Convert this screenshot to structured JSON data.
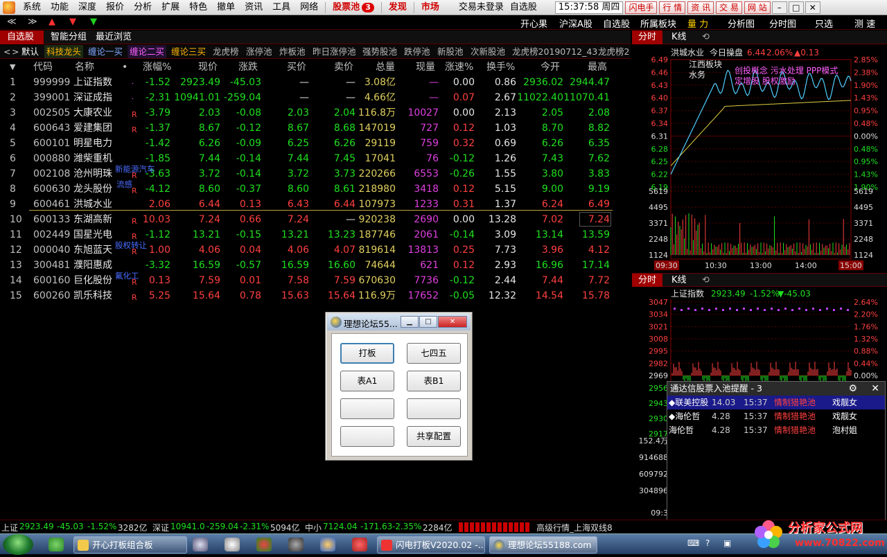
{
  "menubar": {
    "items": [
      "系统",
      "功能",
      "深度",
      "报价",
      "分析",
      "扩展",
      "特色",
      "撤单",
      "资讯",
      "工具",
      "网络"
    ],
    "stock_pool": "股票池",
    "stock_pool_count": "3",
    "discover": "发现",
    "market": "市场",
    "login_status": "交易未登录",
    "watchlist": "自选股",
    "time": "15:37:58 周四",
    "right_buttons": [
      "闪电手",
      "行 情",
      "资 讯",
      "交 易",
      "网 站"
    ]
  },
  "toolbar": {
    "links": [
      "开心果",
      "沪深A股",
      "自选股",
      "所属板块",
      "量 力",
      "分析图",
      "分时图",
      "只选",
      "测 速"
    ]
  },
  "left_tabs": [
    "自选股",
    "智能分组",
    "最近浏览"
  ],
  "sub_tabs": [
    "默认",
    "科技龙头",
    "缠论一买",
    "缠论二买",
    "缠论三买",
    "龙虎榜",
    "涨停池",
    "炸板池",
    "昨日涨停池",
    "强势股池",
    "跌停池",
    "新股池",
    "次新股池",
    "龙虎榜20190712_43",
    "龙虎榜2"
  ],
  "table": {
    "headers": [
      "代码",
      "名称",
      "•",
      "涨幅%",
      "现价",
      "涨跌",
      "买价",
      "卖价",
      "总量",
      "现量",
      "涨速%",
      "换手%",
      "今开",
      "最高"
    ],
    "rows": [
      {
        "n": "1",
        "code": "999999",
        "name": "上证指数",
        "flag": "·",
        "chg": "-1.52",
        "price": "2923.49",
        "diff": "-45.03",
        "bid": "—",
        "ask": "—",
        "vol": "3.08亿",
        "cur": "—",
        "spd": "0.00",
        "turn": "0.86",
        "open": "2936.02",
        "high": "2944.47"
      },
      {
        "n": "2",
        "code": "399001",
        "name": "深证成指",
        "flag": "·",
        "chg": "-2.31",
        "price": "10941.01",
        "diff": "-259.04",
        "bid": "—",
        "ask": "—",
        "vol": "4.66亿",
        "cur": "—",
        "spd": "0.07",
        "turn": "2.67",
        "open": "11022.40",
        "high": "11070.41"
      },
      {
        "n": "3",
        "code": "002505",
        "name": "大康农业",
        "flag": "R",
        "chg": "-3.79",
        "price": "2.03",
        "diff": "-0.08",
        "bid": "2.03",
        "ask": "2.04",
        "vol": "116.8万",
        "cur": "10027",
        "spd": "0.00",
        "turn": "2.13",
        "open": "2.05",
        "high": "2.08"
      },
      {
        "n": "4",
        "code": "600643",
        "name": "爱建集团",
        "flag": "R",
        "chg": "-1.37",
        "price": "8.67",
        "diff": "-0.12",
        "bid": "8.67",
        "ask": "8.68",
        "vol": "147019",
        "cur": "727",
        "spd": "0.12",
        "turn": "1.03",
        "open": "8.70",
        "high": "8.82"
      },
      {
        "n": "5",
        "code": "600101",
        "name": "明星电力",
        "flag": "",
        "chg": "-1.42",
        "price": "6.26",
        "diff": "-0.09",
        "bid": "6.25",
        "ask": "6.26",
        "vol": "29119",
        "cur": "759",
        "spd": "0.32",
        "turn": "0.69",
        "open": "6.26",
        "high": "6.35"
      },
      {
        "n": "6",
        "code": "000880",
        "name": "潍柴重机",
        "flag": "",
        "chg": "-1.85",
        "price": "7.44",
        "diff": "-0.14",
        "bid": "7.44",
        "ask": "7.45",
        "vol": "17041",
        "cur": "76",
        "spd": "-0.12",
        "turn": "1.26",
        "open": "7.43",
        "high": "7.62"
      },
      {
        "n": "7",
        "code": "002108",
        "name": "沧州明珠",
        "flag": "R",
        "chg": "-3.63",
        "price": "3.72",
        "diff": "-0.14",
        "bid": "3.72",
        "ask": "3.73",
        "vol": "220266",
        "cur": "6553",
        "spd": "-0.26",
        "turn": "1.55",
        "open": "3.80",
        "high": "3.83"
      },
      {
        "n": "8",
        "code": "600630",
        "name": "龙头股份",
        "flag": "R",
        "chg": "-4.12",
        "price": "8.60",
        "diff": "-0.37",
        "bid": "8.60",
        "ask": "8.61",
        "vol": "218980",
        "cur": "3418",
        "spd": "0.12",
        "turn": "5.15",
        "open": "9.00",
        "high": "9.19"
      },
      {
        "n": "9",
        "code": "600461",
        "name": "洪城水业",
        "flag": "",
        "chg": "2.06",
        "price": "6.44",
        "diff": "0.13",
        "bid": "6.43",
        "ask": "6.44",
        "vol": "107973",
        "cur": "1233",
        "spd": "0.31",
        "turn": "1.37",
        "open": "6.24",
        "high": "6.49"
      },
      {
        "n": "10",
        "code": "600133",
        "name": "东湖高新",
        "flag": "R",
        "chg": "10.03",
        "price": "7.24",
        "diff": "0.66",
        "bid": "7.24",
        "ask": "—",
        "vol": "920238",
        "cur": "2690",
        "spd": "0.00",
        "turn": "13.28",
        "open": "7.02",
        "high": "7.24"
      },
      {
        "n": "11",
        "code": "002449",
        "name": "国星光电",
        "flag": "R",
        "chg": "-1.12",
        "price": "13.21",
        "diff": "-0.15",
        "bid": "13.21",
        "ask": "13.23",
        "vol": "187746",
        "cur": "2061",
        "spd": "-0.14",
        "turn": "3.09",
        "open": "13.14",
        "high": "13.59"
      },
      {
        "n": "12",
        "code": "000040",
        "name": "东旭蓝天",
        "flag": "R",
        "chg": "1.00",
        "price": "4.06",
        "diff": "0.04",
        "bid": "4.06",
        "ask": "4.07",
        "vol": "819614",
        "cur": "13813",
        "spd": "0.25",
        "turn": "7.73",
        "open": "3.96",
        "high": "4.12"
      },
      {
        "n": "13",
        "code": "300481",
        "name": "濮阳惠成",
        "flag": "",
        "chg": "-3.32",
        "price": "16.59",
        "diff": "-0.57",
        "bid": "16.59",
        "ask": "16.60",
        "vol": "74644",
        "cur": "621",
        "spd": "0.12",
        "turn": "2.93",
        "open": "16.96",
        "high": "17.14"
      },
      {
        "n": "14",
        "code": "600160",
        "name": "巨化股份",
        "flag": "R",
        "chg": "0.13",
        "price": "7.59",
        "diff": "0.01",
        "bid": "7.58",
        "ask": "7.59",
        "vol": "670630",
        "cur": "7736",
        "spd": "-0.12",
        "turn": "2.44",
        "open": "7.44",
        "high": "7.72"
      },
      {
        "n": "15",
        "code": "600260",
        "name": "凯乐科技",
        "flag": "R",
        "chg": "5.25",
        "price": "15.64",
        "diff": "0.78",
        "bid": "15.63",
        "ask": "15.64",
        "vol": "116.9万",
        "cur": "17652",
        "spd": "-0.05",
        "turn": "12.32",
        "open": "14.54",
        "high": "15.78"
      }
    ],
    "annotations": {
      "r7": "新能源汽车",
      "r8": "流感",
      "r12": "股权转让",
      "r14": "氟化工"
    }
  },
  "dialog": {
    "title": "理想论坛55...",
    "buttons": [
      "打板",
      "七四五",
      "表A1",
      "表B1",
      "",
      "",
      "",
      "共享配置"
    ]
  },
  "right_tabs": [
    "分时",
    "K线"
  ],
  "chart1": {
    "stock": "洪城水业",
    "label": "今日操盘",
    "price": "6.44",
    "pct": "2.06%",
    "change": "▲0.13",
    "sector_tag": "江西板块",
    "sector_tag2": "水务",
    "concept_tag": "创投概念 污水处理 PPP模式",
    "concept_tag2": "定增股 股权激励",
    "yaxis_left": [
      "6.49",
      "6.46",
      "6.43",
      "6.40",
      "6.37",
      "6.34",
      "6.31",
      "6.28",
      "6.25",
      "6.22",
      "6.19"
    ],
    "yaxis_right": [
      "2.85%",
      "2.38%",
      "1.90%",
      "1.43%",
      "0.95%",
      "0.48%",
      "0.00%",
      "0.48%",
      "0.95%",
      "1.43%",
      "1.90%"
    ],
    "vol_left": [
      "5619",
      "4495",
      "3371",
      "2248",
      "1124"
    ],
    "vol_right": [
      "5619",
      "4495",
      "3371",
      "2248",
      "1124"
    ],
    "xaxis": [
      "09:30",
      "10:30",
      "13:00",
      "14:00",
      "15:00"
    ]
  },
  "chart2": {
    "stock": "上证指数",
    "price": "2923.49",
    "pct": "-1.52%",
    "change": "▼-45.03",
    "yaxis_left": [
      "3047",
      "3034",
      "3021",
      "3008",
      "2995",
      "2982",
      "2969",
      "2956",
      "2943",
      "2930",
      "2917"
    ],
    "yaxis_right": [
      "2.64%",
      "2.20%",
      "1.76%",
      "1.32%",
      "0.88%",
      "0.44%",
      "0.00%"
    ],
    "vol_left": [
      "152.4万",
      "914688",
      "609792",
      "304896"
    ],
    "xaxis_left": "09:3"
  },
  "popup": {
    "title": "通达信股票入池提醒 - 3",
    "rows": [
      {
        "name": "◆联美控股",
        "price": "14.03",
        "time": "15:37",
        "pool": "情制猎艳池",
        "who": "戏靓女"
      },
      {
        "name": "◆海伦哲",
        "price": "4.28",
        "time": "15:37",
        "pool": "情制猎艳池",
        "who": "戏靓女"
      },
      {
        "name": "海伦哲",
        "price": "4.28",
        "time": "15:37",
        "pool": "情制猎艳池",
        "who": "泡村姐"
      }
    ]
  },
  "status": {
    "sh_label": "上证",
    "sh_val": "2923.49",
    "sh_diff": "-45.03",
    "sh_pct": "-1.52%",
    "sh_amt": "3282亿",
    "sz_label": "深证",
    "sz_val": "10941.0",
    "sz_diff": "-259.04",
    "sz_pct": "-2.31%",
    "sz_amt": "5094亿",
    "zx_label": "中小",
    "zx_val": "7124.04",
    "zx_diff": "-171.63",
    "zx_pct": "-2.35%",
    "zx_amt": "2284亿",
    "mode": "高级行情_上海双线8"
  },
  "taskbar": {
    "tasks": [
      "开心打板组合板",
      "闪电打板V2020.02 -...",
      "理想论坛55188.com"
    ]
  },
  "watermark": {
    "brand": "分析家公式网",
    "url": "www.70822.com"
  }
}
